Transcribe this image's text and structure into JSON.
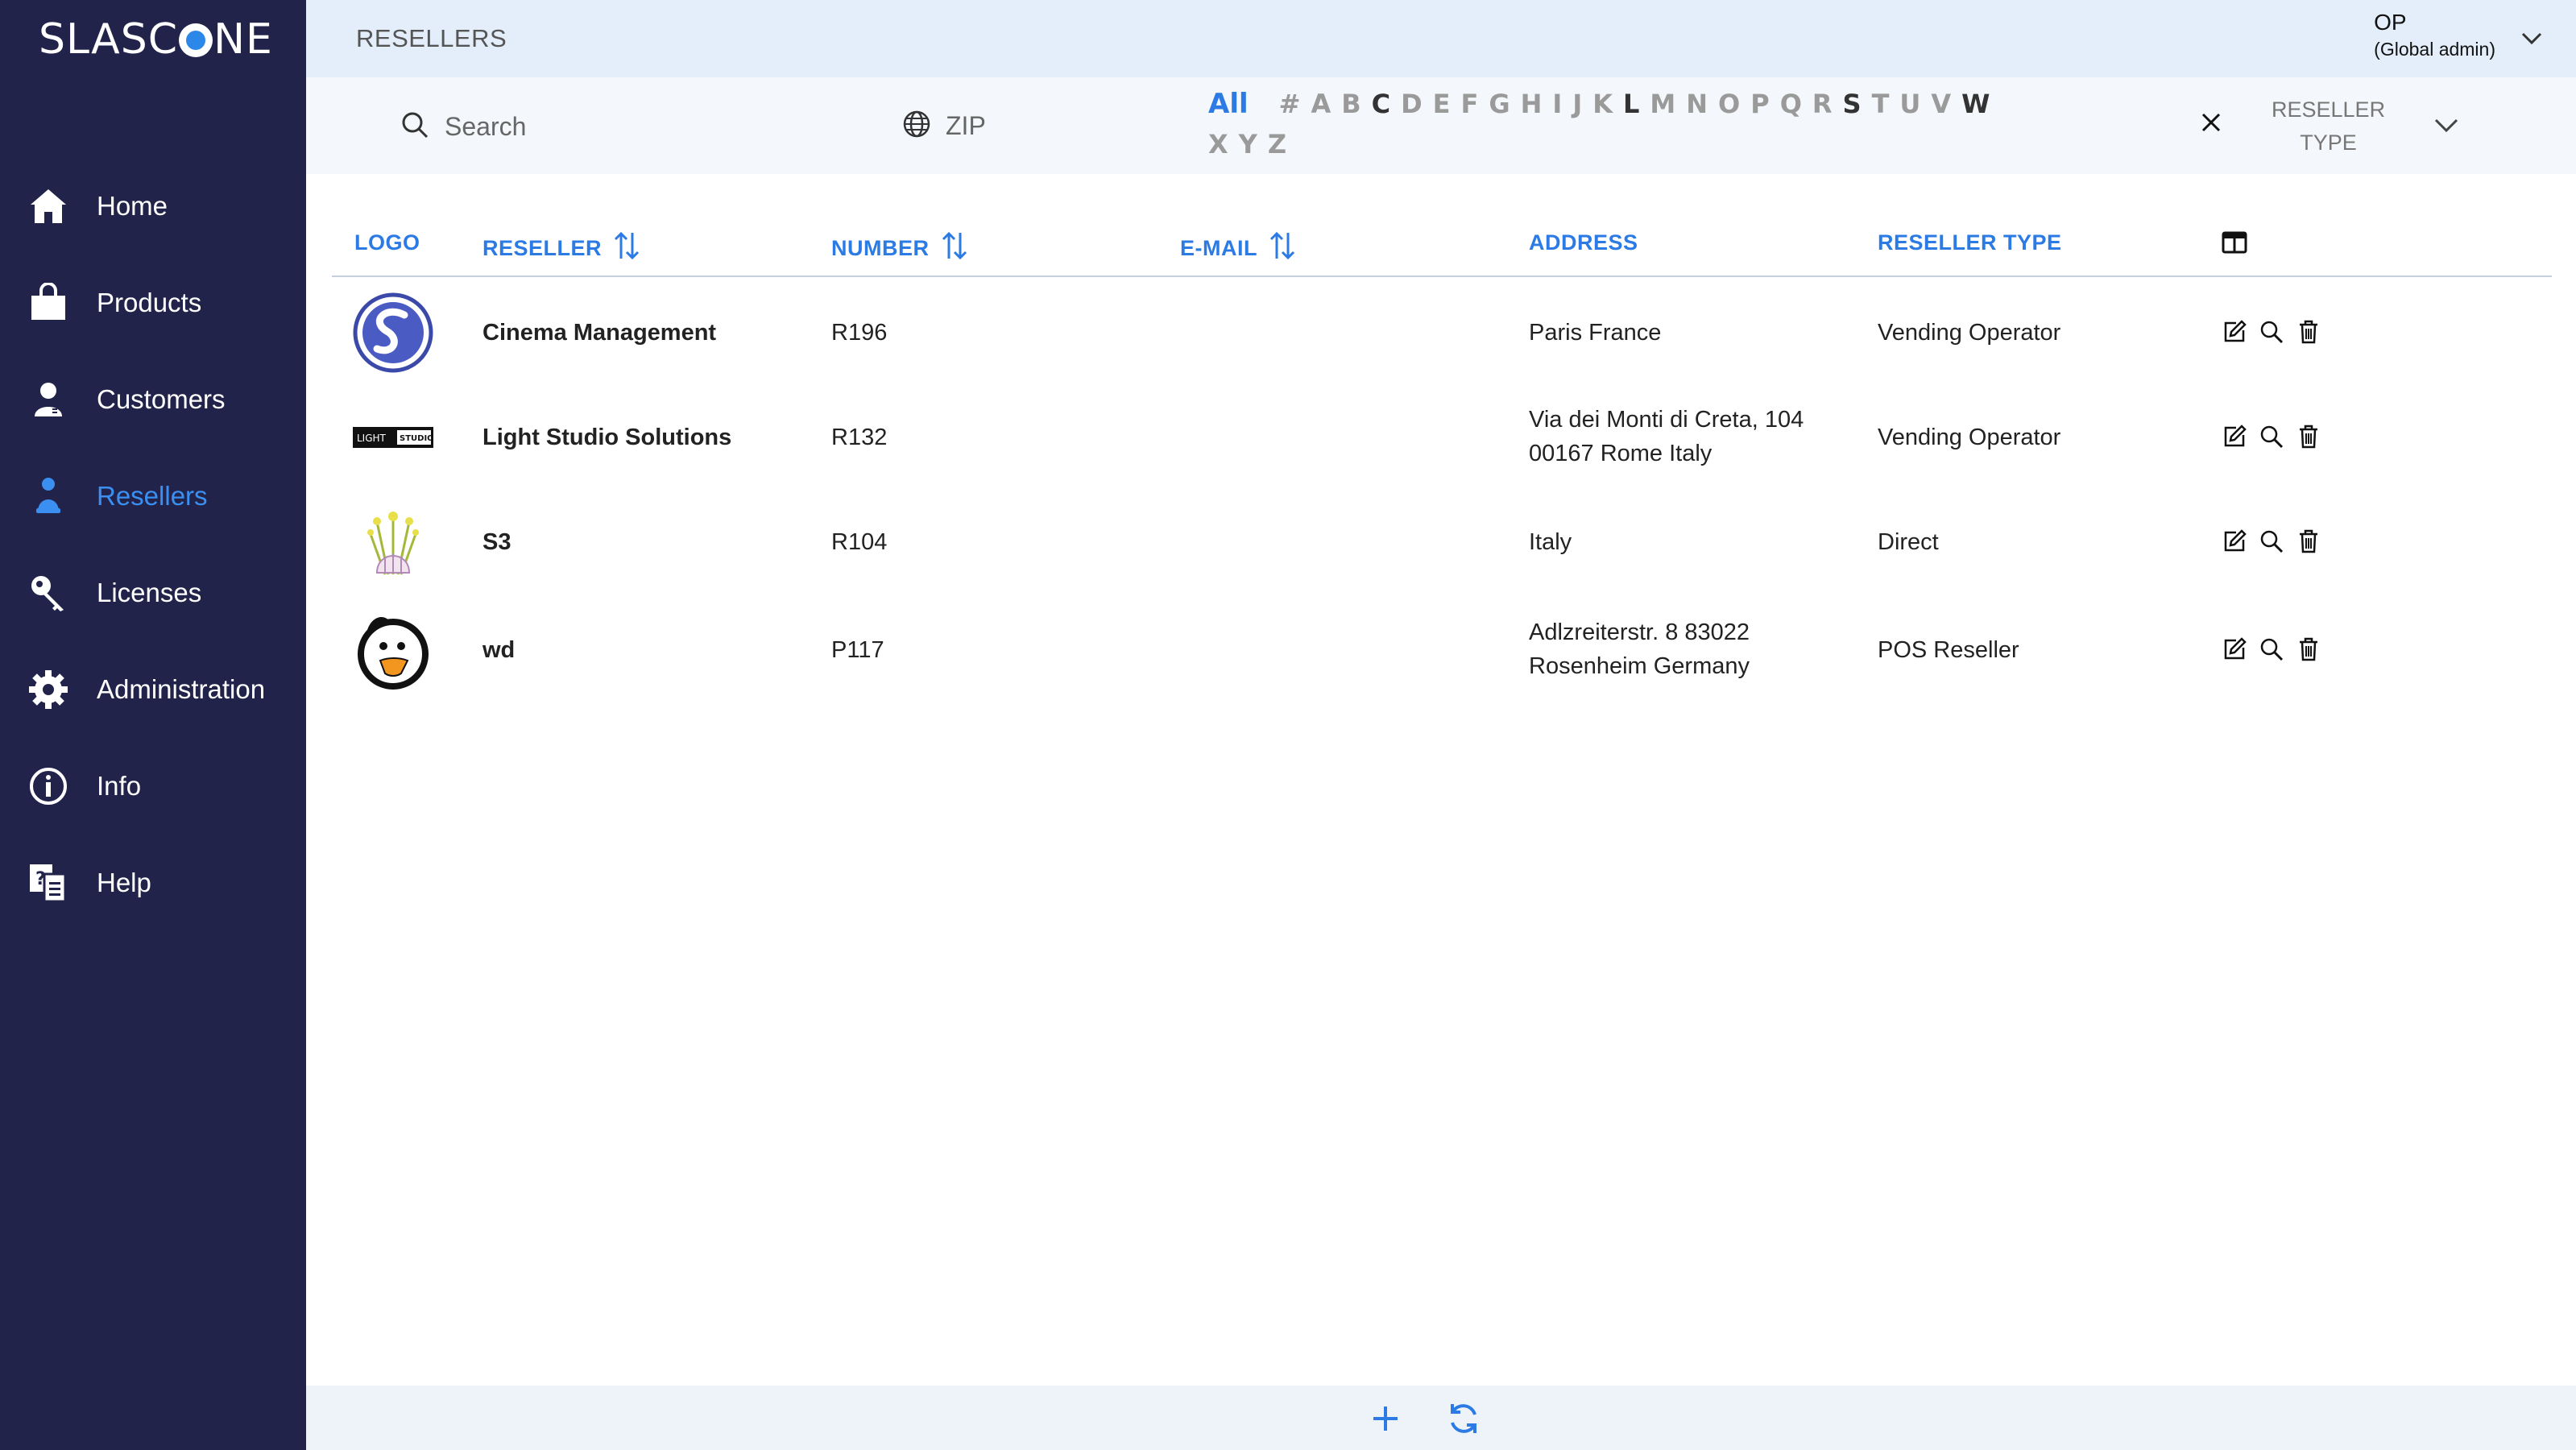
{
  "app": {
    "brand_left": "SLASC",
    "brand_right": "NE"
  },
  "sidebar": {
    "items": [
      {
        "label": "Home",
        "icon": "home-icon"
      },
      {
        "label": "Products",
        "icon": "shopping-bag-icon"
      },
      {
        "label": "Customers",
        "icon": "person-icon"
      },
      {
        "label": "Resellers",
        "icon": "reseller-icon",
        "active": true
      },
      {
        "label": "Licenses",
        "icon": "key-icon"
      },
      {
        "label": "Administration",
        "icon": "gear-icon"
      },
      {
        "label": "Info",
        "icon": "info-icon"
      },
      {
        "label": "Help",
        "icon": "help-icon"
      }
    ]
  },
  "header": {
    "title": "RESELLERS",
    "user_name": "OP",
    "user_role": "(Global admin)"
  },
  "filters": {
    "search_placeholder": "Search",
    "zip_placeholder": "ZIP",
    "alphabet_all": "All",
    "alphabet_row1": [
      "#",
      "A",
      "B",
      "C",
      "D",
      "E",
      "F",
      "G",
      "H",
      "I",
      "J",
      "K",
      "L",
      "M",
      "N",
      "O",
      "P",
      "Q",
      "R",
      "S",
      "T",
      "U",
      "V",
      "W"
    ],
    "alphabet_row2": [
      "X",
      "Y",
      "Z"
    ],
    "alphabet_emphasized": [
      "C",
      "L",
      "S",
      "W"
    ],
    "reseller_type_line1": "RESELLER",
    "reseller_type_line2": "TYPE"
  },
  "table": {
    "headers": {
      "logo": "LOGO",
      "reseller": "RESELLER",
      "number": "NUMBER",
      "email": "E-MAIL",
      "address": "ADDRESS",
      "reseller_type": "RESELLER TYPE"
    },
    "rows": [
      {
        "logo": "slascone-logo",
        "name": "Cinema Management",
        "number": "R196",
        "email": "",
        "address_line1": "Paris France",
        "address_line2": "",
        "type": "Vending Operator"
      },
      {
        "logo": "light-studio-logo",
        "name": "Light Studio Solutions",
        "number": "R132",
        "email": "",
        "address_line1": "Via dei Monti di Creta, 104",
        "address_line2": "00167 Rome Italy",
        "type": "Vending Operator"
      },
      {
        "logo": "flower-logo",
        "name": "S3",
        "number": "R104",
        "email": "",
        "address_line1": "Italy",
        "address_line2": "",
        "type": "Direct"
      },
      {
        "logo": "duck-logo",
        "name": "wd",
        "number": "P117",
        "email": "",
        "address_line1": "Adlzreiterstr. 8 83022",
        "address_line2": "Rosenheim Germany",
        "type": "POS Reseller"
      }
    ],
    "light_studio_logo_text": [
      "LIGHT",
      "STUDIO"
    ]
  },
  "colors": {
    "sidebar_bg": "#22234a",
    "accent": "#2c7be5",
    "header_bg": "#e4eefa"
  }
}
